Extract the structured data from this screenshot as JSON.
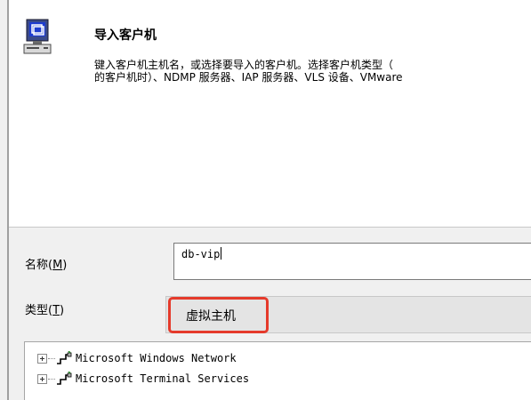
{
  "header": {
    "title": "导入客户机",
    "description_line1": "键入客户机主机名，或选择要导入的客户机。选择客户机类型（",
    "description_line2": "的客户机时）、NDMP 服务器、IAP 服务器、VLS 设备、VMware"
  },
  "form": {
    "name_label_text": "名称(",
    "name_label_key": "M",
    "name_label_end": ")",
    "name_value": "db-vip",
    "type_label_text": "类型(",
    "type_label_key": "T",
    "type_label_end": ")",
    "type_value": "虚拟主机"
  },
  "tree": {
    "items": [
      {
        "label": "Microsoft Windows Network",
        "icon": "network-icon"
      },
      {
        "label": "Microsoft Terminal Services",
        "icon": "network-icon"
      }
    ]
  },
  "colors": {
    "highlight": "#e53a2b",
    "header_bg": "#ffffff",
    "window_bg": "#f0f0f0"
  }
}
